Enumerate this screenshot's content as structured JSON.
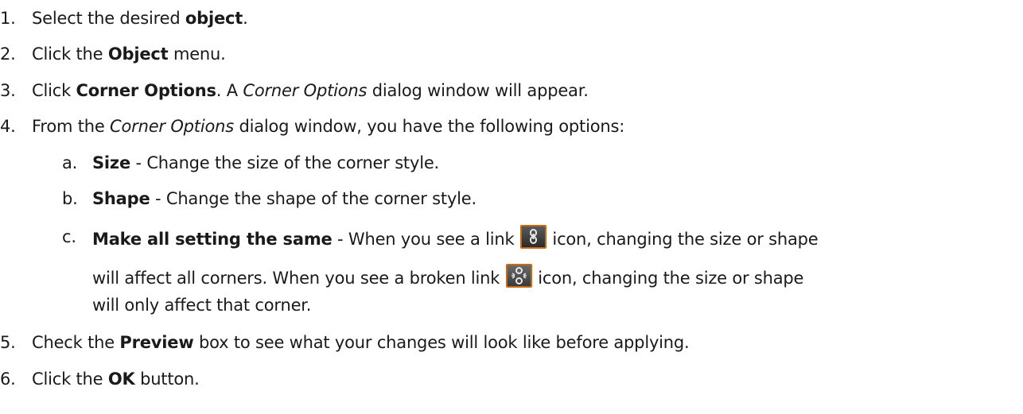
{
  "steps": [
    {
      "num": "1.",
      "parts": [
        "Select the desired ",
        "object",
        "."
      ]
    },
    {
      "num": "2.",
      "parts": [
        "Click the ",
        "Object",
        " menu."
      ]
    },
    {
      "num": "3.",
      "parts": [
        "Click ",
        "Corner Options",
        ". A ",
        "Corner Options",
        " dialog window will appear."
      ]
    },
    {
      "num": "4.",
      "parts": [
        "From the ",
        "Corner Options",
        " dialog window, you have the following options:"
      ]
    },
    {
      "num": "5.",
      "parts": [
        "Check the ",
        "Preview",
        " box to see what your changes will look like before applying."
      ]
    },
    {
      "num": "6.",
      "parts": [
        "Click the ",
        "OK",
        " button."
      ]
    }
  ],
  "substeps": [
    {
      "num": "a.",
      "parts": [
        "Size",
        " - Change the size of the corner style."
      ]
    },
    {
      "num": "b.",
      "parts": [
        "Shape",
        " - Change the shape of the corner style."
      ]
    },
    {
      "num": "c.",
      "parts": [
        "Make all setting the same",
        " - When you see a link ",
        " icon, changing the size or shape"
      ],
      "continuation": [
        "will affect all corners. When you see a broken link ",
        " icon, changing the size or shape"
      ],
      "continuation2": "will only affect that corner."
    }
  ],
  "icons": {
    "link": "link-icon",
    "broken_link": "broken-link-icon",
    "icon_border_color": "#c96a12"
  }
}
